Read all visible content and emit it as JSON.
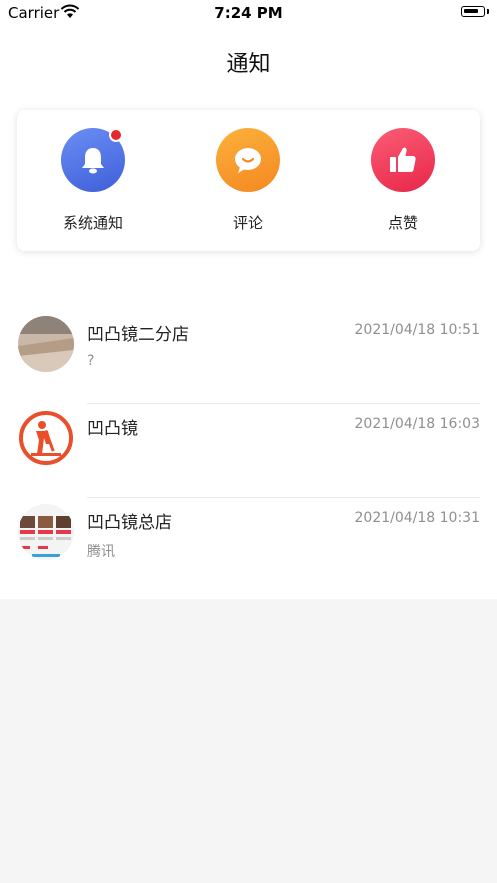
{
  "status_bar": {
    "carrier": "Carrier",
    "time": "7:24 PM"
  },
  "nav": {
    "title": "通知"
  },
  "categories": [
    {
      "label": "系统通知",
      "icon": "bell-icon",
      "color": "#4f72e6",
      "has_badge": true
    },
    {
      "label": "评论",
      "icon": "chat-bubble-icon",
      "color": "#f79a2a",
      "has_badge": false
    },
    {
      "label": "点赞",
      "icon": "thumbs-up-icon",
      "color": "#f0405b",
      "has_badge": false
    }
  ],
  "messages": [
    {
      "name": "凹凸镜二分店",
      "time": "2021/04/18 10:51",
      "preview": "?"
    },
    {
      "name": "凹凸镜",
      "time": "2021/04/18 16:03",
      "preview": ""
    },
    {
      "name": "凹凸镜总店",
      "time": "2021/04/18 10:31",
      "preview": "腾讯"
    }
  ],
  "colors": {
    "badge": "#e8262d",
    "text_secondary": "#8f8f8f",
    "background": "#f5f5f5"
  }
}
